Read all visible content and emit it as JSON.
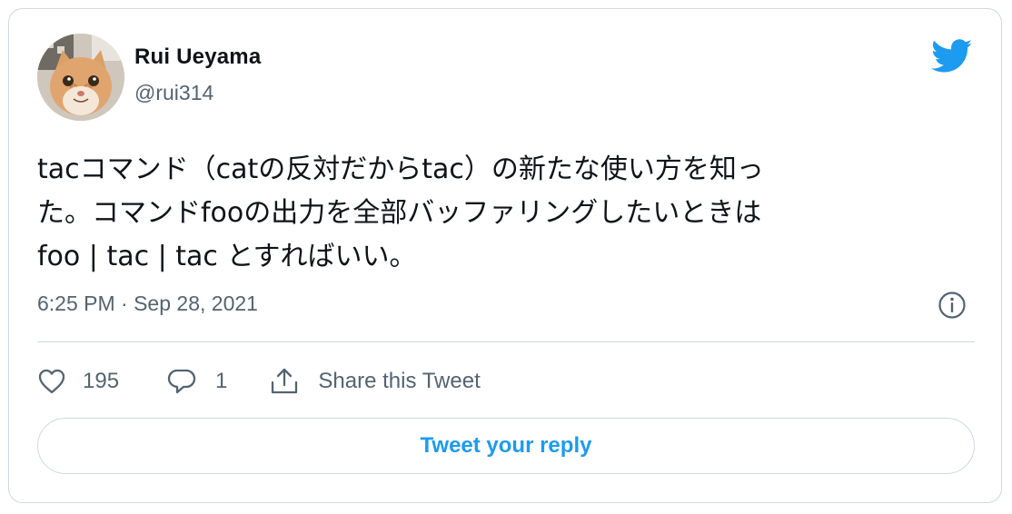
{
  "author": {
    "name": "Rui Ueyama",
    "handle": "@rui314",
    "avatar_icon": "cat-photo-avatar"
  },
  "brand": {
    "icon": "twitter-bird-icon",
    "color": "#1d9bf0"
  },
  "tweet": {
    "lines": [
      "tacコマンド（catの反対だからtac）の新たな使い方を知っ",
      "た。コマンドfooの出力を全部バッファリングしたいときは",
      "foo | tac | tac とすればいい。"
    ],
    "timestamp": "6:25 PM · Sep 28, 2021"
  },
  "actions": {
    "like_count": "195",
    "reply_count": "1",
    "share_label": "Share this Tweet"
  },
  "reply_button_label": "Tweet your reply",
  "colors": {
    "text": "#0f1419",
    "secondary": "#536471",
    "border": "#cfd9de",
    "accent": "#1d9bf0"
  }
}
